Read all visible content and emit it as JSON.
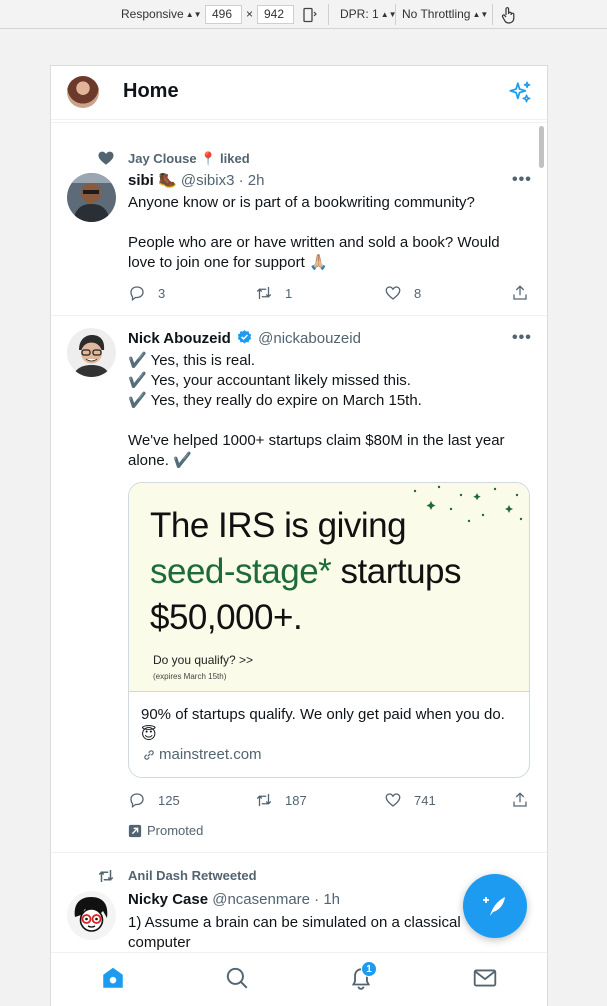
{
  "devtools": {
    "device": "Responsive",
    "width": "496",
    "times": "×",
    "height": "942",
    "dpr": "DPR: 1",
    "throttling": "No Throttling"
  },
  "header": {
    "title": "Home"
  },
  "tweets": [
    {
      "context": "Jay Clouse 📍 liked",
      "name": "sibi 🥾",
      "handle": "@sibix3 · 2h",
      "more": "•••",
      "lines": [
        "Anyone know or is part of a bookwriting community?",
        "",
        "People who are or have written and sold a book? Would love to join one for support 🙏🏼"
      ],
      "replies": "3",
      "retweets": "1",
      "likes": "8"
    },
    {
      "name": "Nick Abouzeid",
      "handle": "@nickabouzeid",
      "more": "•••",
      "lines": [
        "✔️ Yes, this is real.",
        "✔️ Yes, your accountant likely missed this.",
        "✔️ Yes, they really do expire on March 15th.",
        "",
        "We've helped 1000+ startups claim $80M in the last year alone. ✔️"
      ],
      "card": {
        "headline_1": "The IRS is giving",
        "headline_green": "seed-stage*",
        "headline_2": " startups",
        "headline_3": "$50,000+.",
        "question": "Do you qualify? >>",
        "expires": "(expires March 15th)",
        "description": "90% of startups qualify. We only get paid when you do. 😇",
        "link": "mainstreet.com"
      },
      "replies": "125",
      "retweets": "187",
      "likes": "741",
      "promoted": "Promoted"
    },
    {
      "context": "Anil Dash Retweeted",
      "name": "Nicky Case",
      "handle": "@ncasenmare · 1h",
      "lines": [
        "1) Assume a brain can be simulated on a classical computer"
      ]
    }
  ],
  "nav": {
    "notifications_badge": "1"
  },
  "colors": {
    "accent": "#1d9bf0",
    "secondary_text": "#536471",
    "card_green": "#1e6b3a"
  }
}
